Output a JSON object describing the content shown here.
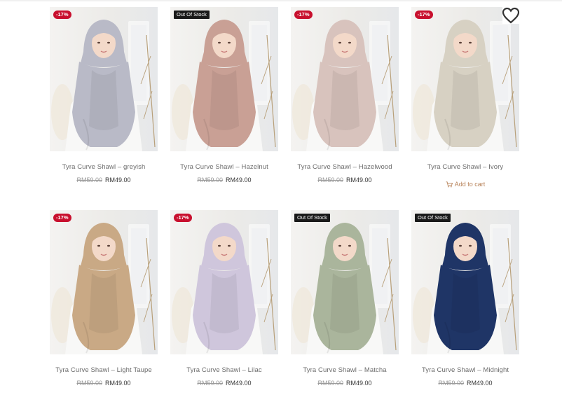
{
  "products": [
    {
      "title": "Tyra Curve Shawl – greyish",
      "old_price": "RM59.00",
      "price": "RM49.00",
      "badge": "-17%",
      "badge_type": "sale",
      "color": "#b9bac7"
    },
    {
      "title": "Tyra Curve Shawl – Hazelnut",
      "old_price": "RM59.00",
      "price": "RM49.00",
      "badge": "Out Of Stock",
      "badge_type": "oos",
      "color": "#c9a095"
    },
    {
      "title": "Tyra Curve Shawl – Hazelwood",
      "old_price": "RM59.00",
      "price": "RM49.00",
      "badge": "-17%",
      "badge_type": "sale",
      "color": "#d8c3bd"
    },
    {
      "title": "Tyra Curve Shawl – Ivory",
      "old_price": "",
      "price": "",
      "badge": "-17%",
      "badge_type": "sale",
      "color": "#d7d1c3",
      "wishlist": true,
      "add_to_cart": "Add to cart"
    },
    {
      "title": "Tyra Curve Shawl – Light Taupe",
      "old_price": "RM59.00",
      "price": "RM49.00",
      "badge": "-17%",
      "badge_type": "sale",
      "color": "#c9a985"
    },
    {
      "title": "Tyra Curve Shawl – Lilac",
      "old_price": "RM59.00",
      "price": "RM49.00",
      "badge": "-17%",
      "badge_type": "sale",
      "color": "#cfc6dc"
    },
    {
      "title": "Tyra Curve Shawl – Matcha",
      "old_price": "RM59.00",
      "price": "RM49.00",
      "badge": "Out Of Stock",
      "badge_type": "oos",
      "color": "#aab59c"
    },
    {
      "title": "Tyra Curve Shawl – Midnight",
      "old_price": "RM59.00",
      "price": "RM49.00",
      "badge": "Out Of Stock",
      "badge_type": "oos",
      "color": "#1f3566"
    }
  ],
  "icons": {
    "wishlist": "heart-icon",
    "cart": "cart-icon"
  },
  "colors": {
    "sale_badge": "#c8102e",
    "oos_badge": "#1a1a1a",
    "add_to_cart": "#b8835a",
    "title_text": "#6b6b6b"
  }
}
